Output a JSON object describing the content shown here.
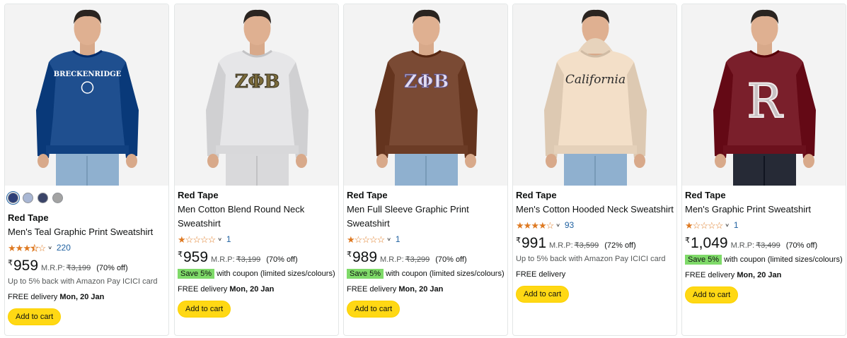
{
  "products": [
    {
      "brand": "Red Tape",
      "title": "Men's Teal Graphic Print Sweatshirt",
      "rating": 3.5,
      "rating_count": "220",
      "currency": "₹",
      "price": "959",
      "mrp_label": "M.R.P:",
      "mrp": "₹3,199",
      "discount": "(70% off)",
      "cashback": "Up to 5% back with Amazon Pay ICICI card",
      "delivery_prefix": "FREE delivery",
      "delivery_date": "Mon, 20 Jan",
      "cart_label": "Add to cart",
      "swatches": [
        "#2d3f78",
        "#a9b7d4",
        "#3a4468",
        "#a3a3a3"
      ],
      "image": {
        "garment": "#1f4f8f",
        "print": "BRECKENRIDGE",
        "background": "#f3f3f3"
      }
    },
    {
      "brand": "Red Tape",
      "title": "Men Cotton Blend Round Neck Sweatshirt",
      "rating": 1,
      "rating_count": "1",
      "currency": "₹",
      "price": "959",
      "mrp_label": "M.R.P:",
      "mrp": "₹3,199",
      "discount": "(70% off)",
      "coupon_badge": "Save 5%",
      "coupon_text": "with coupon (limited sizes/colours)",
      "delivery_prefix": "FREE delivery",
      "delivery_date": "Mon, 20 Jan",
      "cart_label": "Add to cart",
      "image": {
        "garment": "#e6e6e8",
        "print": "ΖΦΒ",
        "background": "#f3f3f3"
      }
    },
    {
      "brand": "Red Tape",
      "title": "Men Full Sleeve Graphic Print Sweatshirt",
      "rating": 1,
      "rating_count": "1",
      "currency": "₹",
      "price": "989",
      "mrp_label": "M.R.P:",
      "mrp": "₹3,299",
      "discount": "(70% off)",
      "coupon_badge": "Save 5%",
      "coupon_text": "with coupon (limited sizes/colours)",
      "delivery_prefix": "FREE delivery",
      "delivery_date": "Mon, 20 Jan",
      "cart_label": "Add to cart",
      "image": {
        "garment": "#7a4a34",
        "print": "ΖΦΒ",
        "background": "#f3f3f3"
      }
    },
    {
      "brand": "Red Tape",
      "title": "Men's Cotton Hooded Neck Sweatshirt",
      "rating": 4,
      "rating_count": "93",
      "currency": "₹",
      "price": "991",
      "mrp_label": "M.R.P:",
      "mrp": "₹3,599",
      "discount": "(72% off)",
      "cashback": "Up to 5% back with Amazon Pay ICICI card",
      "delivery_prefix": "FREE delivery",
      "delivery_date": "",
      "cart_label": "Add to cart",
      "image": {
        "garment": "#f3dfc8",
        "print": "California",
        "background": "#f3f3f3"
      }
    },
    {
      "brand": "Red Tape",
      "title": "Men's Graphic Print Sweatshirt",
      "rating": 1,
      "rating_count": "1",
      "currency": "₹",
      "price": "1,049",
      "mrp_label": "M.R.P:",
      "mrp": "₹3,499",
      "discount": "(70% off)",
      "coupon_badge": "Save 5%",
      "coupon_text": "with coupon (limited sizes/colours)",
      "delivery_prefix": "FREE delivery",
      "delivery_date": "Mon, 20 Jan",
      "cart_label": "Add to cart",
      "image": {
        "garment": "#7a1f2b",
        "print": "R",
        "background": "#f3f3f3"
      }
    }
  ]
}
